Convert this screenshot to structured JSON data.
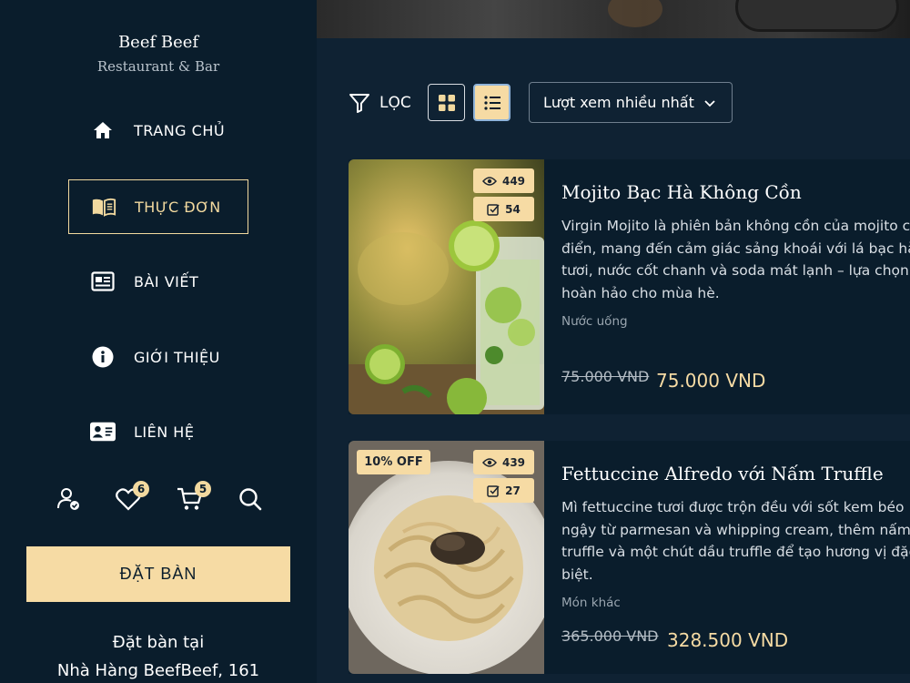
{
  "brand": {
    "name": "Beef Beef",
    "subtitle": "Restaurant & Bar"
  },
  "nav": [
    {
      "label": "TRANG CHỦ",
      "icon": "home-icon"
    },
    {
      "label": "THỰC ĐƠN",
      "icon": "menu-book-icon",
      "active": true
    },
    {
      "label": "BÀI VIẾT",
      "icon": "article-icon"
    },
    {
      "label": "GIỚI THIỆU",
      "icon": "info-icon"
    },
    {
      "label": "LIÊN HỆ",
      "icon": "contact-card-icon"
    }
  ],
  "utilities": {
    "favorites_count": "6",
    "cart_count": "5"
  },
  "booking": {
    "button_label": "ĐẶT BÀN",
    "line1": "Đặt bàn tại",
    "line2": "Nhà Hàng BeefBeef, 161"
  },
  "toolbar": {
    "filter_label": "LỌC",
    "sort_value": "Lượt xem nhiều nhất",
    "active_view": "list"
  },
  "items": [
    {
      "badge": "",
      "views": "449",
      "orders": "54",
      "title": "Mojito Bạc Hà Không Cồn",
      "description": [
        "Virgin Mojito là phiên bản không cồn của mojito c",
        "điển, mang đến cảm giác sảng khoái với lá bạc hà",
        "tươi, nước cốt chanh và soda mát lạnh – lựa chọn",
        "hoàn hảo cho mùa hè."
      ],
      "category": "Nước uống",
      "old_price": "75.000 VND",
      "price": "75.000 VND"
    },
    {
      "badge": "10% OFF",
      "views": "439",
      "orders": "27",
      "title": "Fettuccine Alfredo với Nấm Truffle",
      "description": [
        "Mì fettuccine tươi được trộn đều với sốt kem béo",
        "ngậy từ parmesan và whipping cream, thêm nấm",
        "truffle và một chút dầu truffle để tạo hương vị đặc",
        "biệt."
      ],
      "category": "Món khác",
      "old_price": "365.000 VND",
      "price": "328.500 VND"
    }
  ],
  "colors": {
    "sidebar": "#0a1d2c",
    "main": "#0f2233",
    "accent": "#f6dba4"
  }
}
